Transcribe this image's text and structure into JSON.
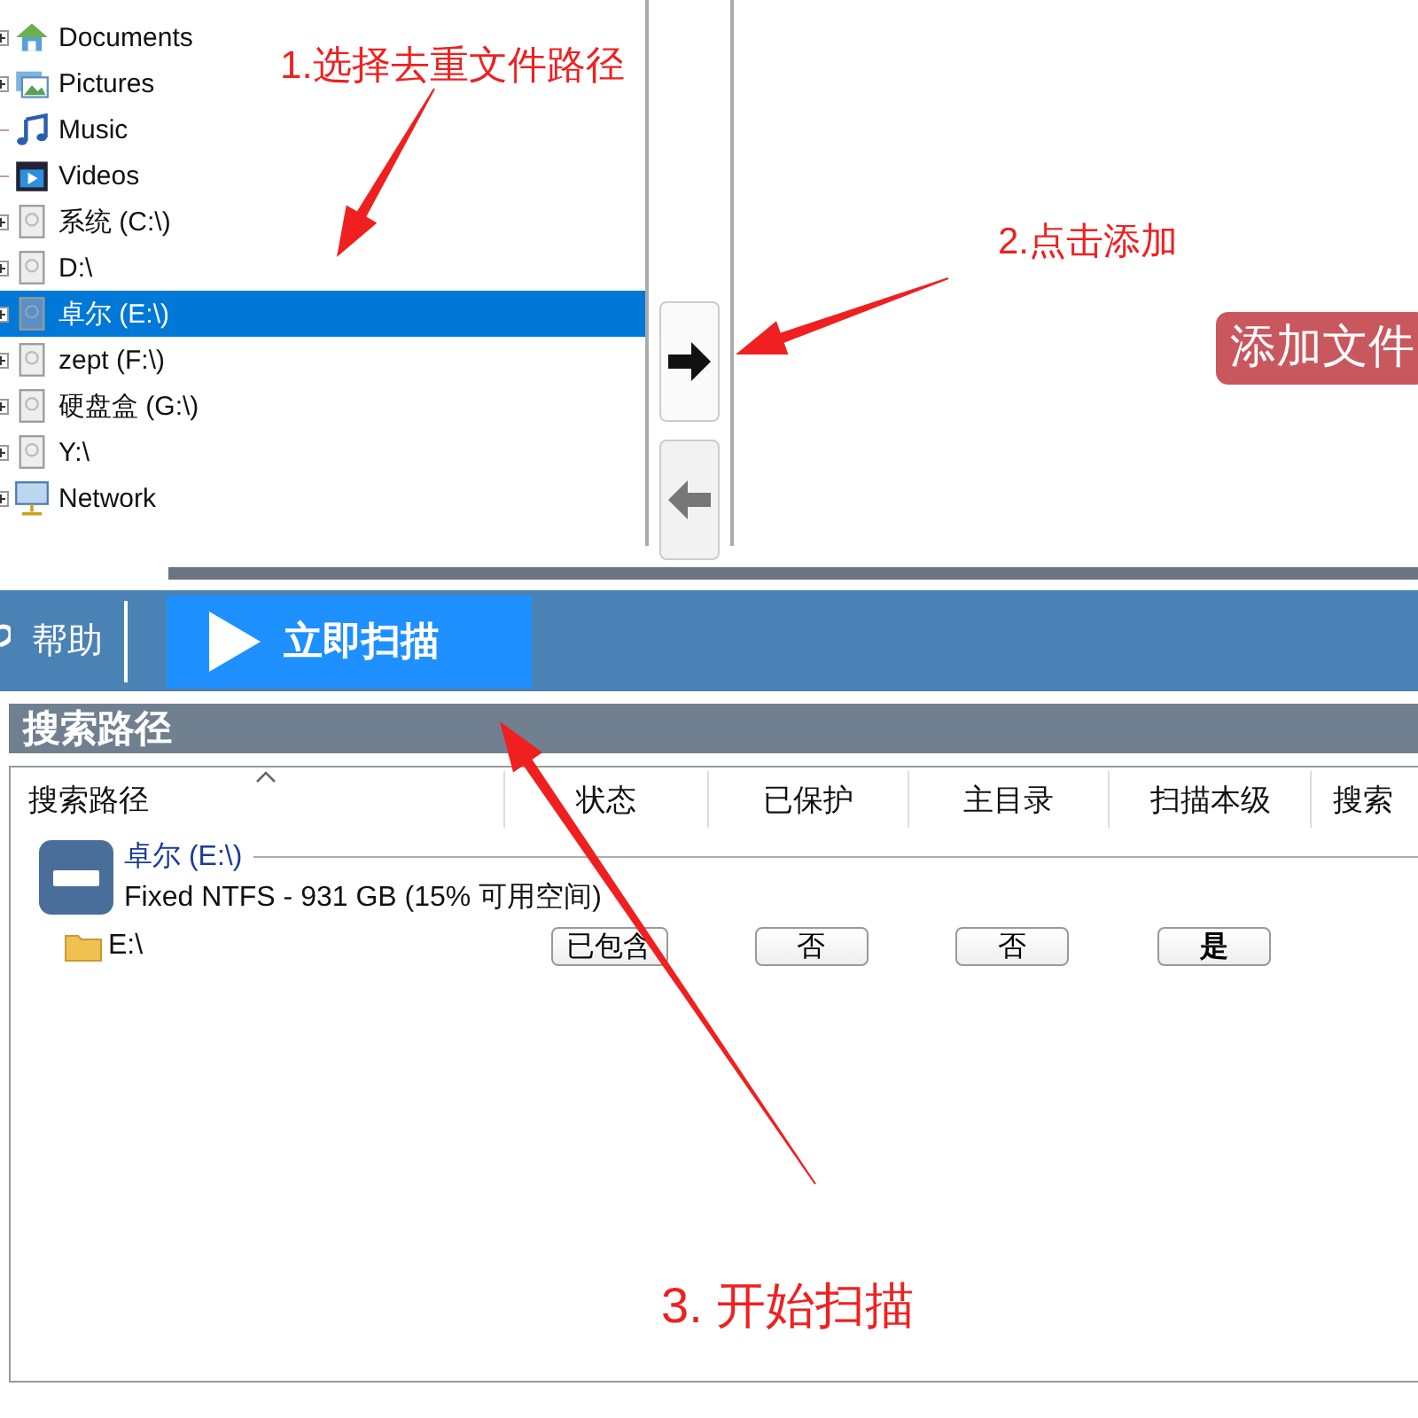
{
  "tree": {
    "items": [
      {
        "label": "Documents",
        "kind": "home",
        "expandable": true,
        "selected": false
      },
      {
        "label": "Pictures",
        "kind": "pictures",
        "expandable": true,
        "selected": false
      },
      {
        "label": "Music",
        "kind": "music",
        "expandable": false,
        "selected": false
      },
      {
        "label": "Videos",
        "kind": "video",
        "expandable": false,
        "selected": false
      },
      {
        "label": "系统 (C:\\)",
        "kind": "drive",
        "expandable": true,
        "selected": false
      },
      {
        "label": "D:\\",
        "kind": "drive",
        "expandable": true,
        "selected": false
      },
      {
        "label": "卓尔 (E:\\)",
        "kind": "drive",
        "expandable": true,
        "selected": true
      },
      {
        "label": "zept (F:\\)",
        "kind": "drive",
        "expandable": true,
        "selected": false
      },
      {
        "label": "硬盘盒 (G:\\)",
        "kind": "drive",
        "expandable": true,
        "selected": false
      },
      {
        "label": "Y:\\",
        "kind": "drive",
        "expandable": true,
        "selected": false
      },
      {
        "label": "Network",
        "kind": "network",
        "expandable": true,
        "selected": false
      }
    ]
  },
  "move_buttons": [
    {
      "kind": "right",
      "disabled": false
    },
    {
      "kind": "left",
      "disabled": true
    }
  ],
  "add_badge": "添加文件",
  "toolbar": {
    "help": "帮助",
    "scan_button": "立即扫描"
  },
  "section_title": "搜索路径",
  "table": {
    "columns": [
      "搜索路径",
      "状态",
      "已保护",
      "主目录",
      "扫描本级",
      "搜索"
    ],
    "drive": {
      "name": "卓尔 (E:\\)",
      "info": "Fixed NTFS - 931 GB (15% 可用空间)"
    },
    "rows": [
      {
        "cells": [
          {
            "text": "E:\\",
            "bold": false
          },
          {
            "text": "已包含",
            "bold": false
          },
          {
            "text": "否",
            "bold": false
          },
          {
            "text": "否",
            "bold": false
          },
          {
            "text": "是",
            "bold": true
          }
        ]
      }
    ]
  },
  "annotations": [
    {
      "text": "1.选择去重文件路径"
    },
    {
      "text": "2.点击添加"
    },
    {
      "text": "3. 开始扫描"
    }
  ]
}
